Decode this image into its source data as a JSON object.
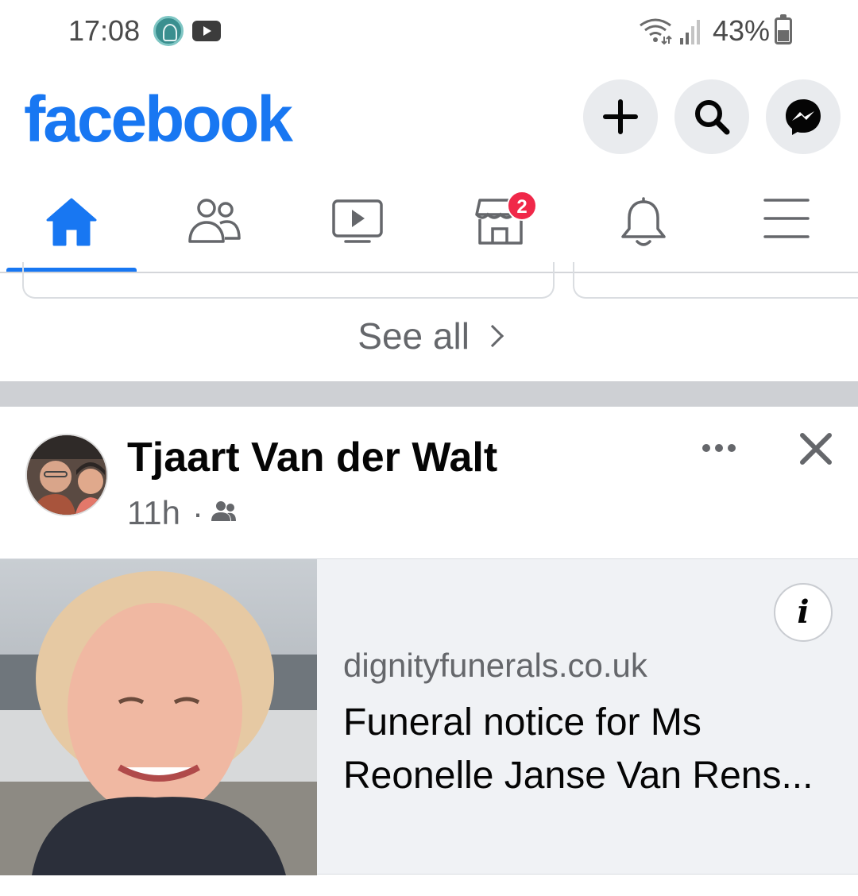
{
  "status_bar": {
    "time": "17:08",
    "battery": "43%",
    "icons": [
      "tree-app-icon",
      "youtube-icon",
      "wifi-icon",
      "signal-icon",
      "battery-icon"
    ]
  },
  "header": {
    "logo": "facebook",
    "brand_color": "#1877f2",
    "actions": [
      "add-icon",
      "search-icon",
      "messenger-icon"
    ]
  },
  "tabs": [
    {
      "name": "home",
      "icon": "home-icon",
      "active": true
    },
    {
      "name": "friends",
      "icon": "friends-icon"
    },
    {
      "name": "watch",
      "icon": "video-icon"
    },
    {
      "name": "marketplace",
      "icon": "marketplace-icon",
      "badge": "2"
    },
    {
      "name": "notifications",
      "icon": "bell-icon"
    },
    {
      "name": "menu",
      "icon": "hamburger-icon"
    }
  ],
  "see_all": {
    "label": "See all"
  },
  "post": {
    "author": "Tjaart Van der Walt",
    "time": "11h",
    "separator": "·",
    "audience_icon": "friends-audience-icon",
    "link": {
      "domain": "dignityfunerals.co.uk",
      "title_line1": "Funeral notice for Ms",
      "title_line2": "Reonelle Janse Van Rens..."
    }
  }
}
